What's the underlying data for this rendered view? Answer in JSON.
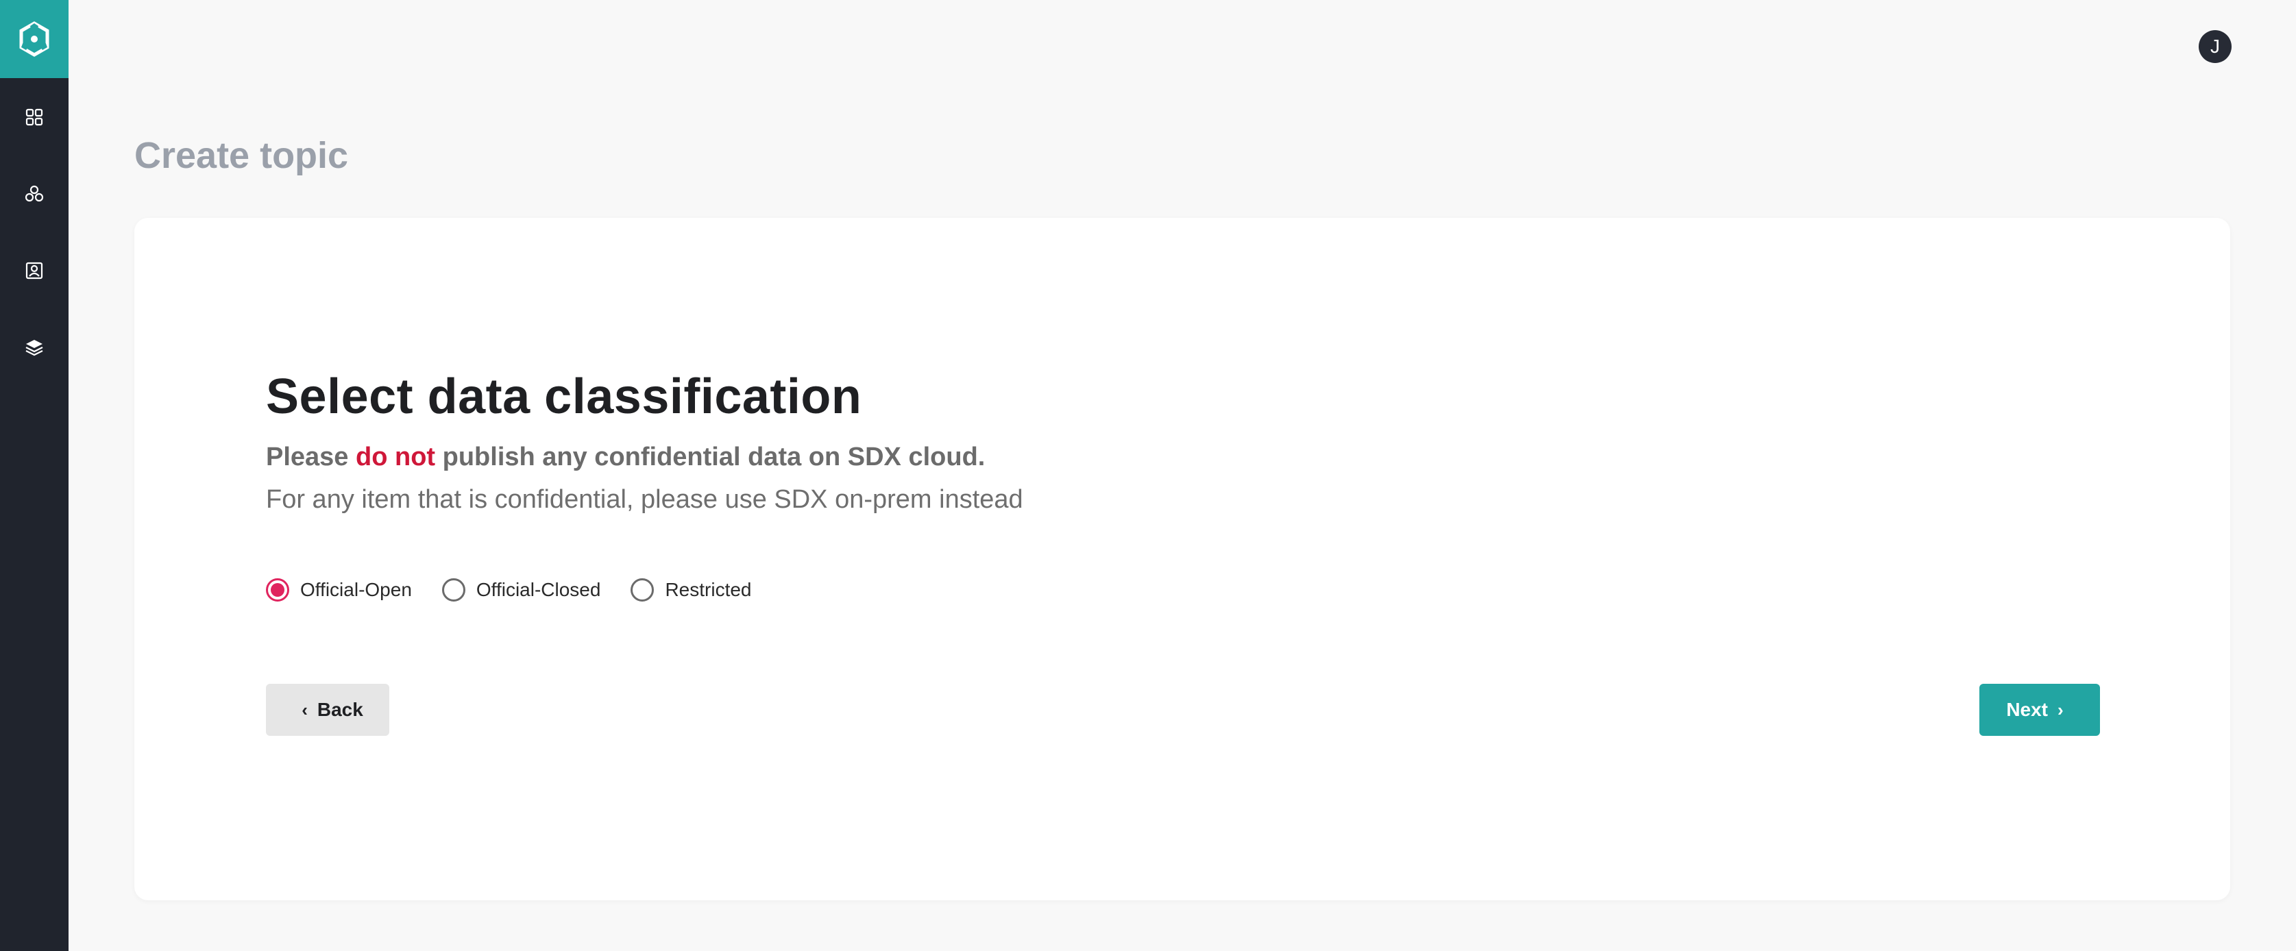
{
  "sidebar": {
    "logo_icon": "cube-logo-icon",
    "items": [
      {
        "icon": "grid-icon"
      },
      {
        "icon": "network-icon"
      },
      {
        "icon": "contact-card-icon"
      },
      {
        "icon": "layers-icon"
      }
    ]
  },
  "header": {
    "avatar_initial": "J"
  },
  "page": {
    "title": "Create topic"
  },
  "form": {
    "heading": "Select data classification",
    "warning_prefix": "Please ",
    "warning_emphasis": "do not",
    "warning_suffix": " publish any confidential data on SDX cloud.",
    "subtext": "For any item that is confidential, please use SDX on-prem instead",
    "options": [
      {
        "label": "Official-Open",
        "selected": true
      },
      {
        "label": "Official-Closed",
        "selected": false
      },
      {
        "label": "Restricted",
        "selected": false
      }
    ],
    "back_label": "Back",
    "next_label": "Next"
  },
  "colors": {
    "sidebar_bg": "#20242d",
    "accent_teal": "#22a5a2",
    "radio_selected": "#e0245e",
    "danger_text": "#cf1739"
  }
}
